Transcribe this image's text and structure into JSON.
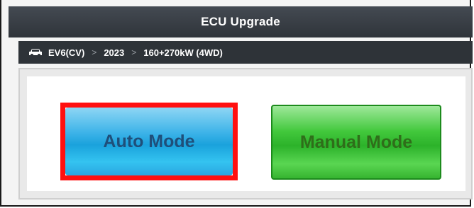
{
  "header": {
    "title": "ECU Upgrade"
  },
  "breadcrumb": {
    "icon": "car-icon",
    "items": [
      "EV6(CV)",
      "2023",
      "160+270kW (4WD)"
    ],
    "separator": ">"
  },
  "modes": {
    "auto_label": "Auto Mode",
    "manual_label": "Manual Mode",
    "selected": "Auto Mode"
  },
  "colors": {
    "selection_border": "#ff1010",
    "auto_button": "#1aa2dc",
    "manual_button": "#2cb22a",
    "title_bar": "#3a3f45"
  }
}
